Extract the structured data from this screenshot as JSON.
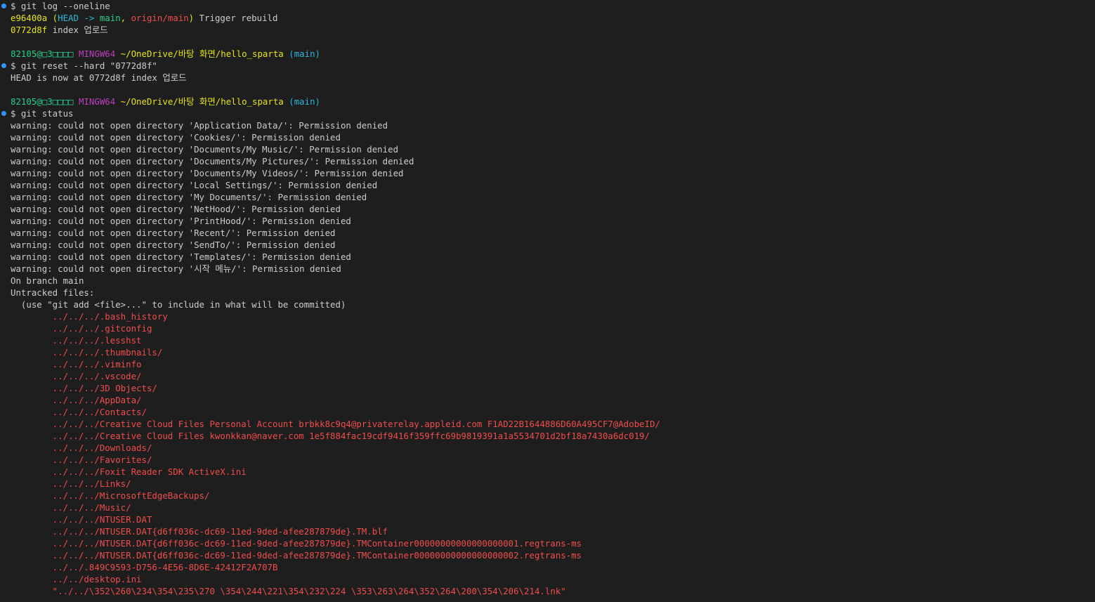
{
  "theme": {
    "background": "#1e1e1e",
    "foreground": "#cccccc",
    "marker": "#3794ff",
    "yellow": "#e5e510",
    "cyan": "#29b8db",
    "green": "#23d18b",
    "red": "#f14c4c",
    "magenta": "#bc3fbc"
  },
  "lines": [
    {
      "marker": true,
      "segments": [
        {
          "text": "$ git log --oneline",
          "c": "default"
        }
      ]
    },
    {
      "segments": [
        {
          "text": "e96400a",
          "c": "yellow"
        },
        {
          "text": " (",
          "c": "yellow"
        },
        {
          "text": "HEAD -> ",
          "c": "cyan"
        },
        {
          "text": "main",
          "c": "green"
        },
        {
          "text": ", ",
          "c": "yellow"
        },
        {
          "text": "origin/main",
          "c": "red"
        },
        {
          "text": ")",
          "c": "yellow"
        },
        {
          "text": " Trigger rebuild",
          "c": "default"
        }
      ]
    },
    {
      "segments": [
        {
          "text": "0772d8f",
          "c": "yellow"
        },
        {
          "text": " index 업로드",
          "c": "default"
        }
      ]
    },
    {
      "segments": []
    },
    {
      "segments": [
        {
          "text": "82105@□3□□□□",
          "c": "green"
        },
        {
          "text": " MINGW64",
          "c": "magenta"
        },
        {
          "text": " ~/OneDrive/바탕 화면/hello_sparta",
          "c": "yellow"
        },
        {
          "text": " (main)",
          "c": "cyan"
        }
      ]
    },
    {
      "marker": true,
      "segments": [
        {
          "text": "$ git reset --hard \"0772d8f\"",
          "c": "default"
        }
      ]
    },
    {
      "segments": [
        {
          "text": "HEAD is now at 0772d8f index 업로드",
          "c": "default"
        }
      ]
    },
    {
      "segments": []
    },
    {
      "segments": [
        {
          "text": "82105@□3□□□□",
          "c": "green"
        },
        {
          "text": " MINGW64",
          "c": "magenta"
        },
        {
          "text": " ~/OneDrive/바탕 화면/hello_sparta",
          "c": "yellow"
        },
        {
          "text": " (main)",
          "c": "cyan"
        }
      ]
    },
    {
      "marker": true,
      "segments": [
        {
          "text": "$ git status",
          "c": "default"
        }
      ]
    },
    {
      "segments": [
        {
          "text": "warning: could not open directory 'Application Data/': Permission denied",
          "c": "default"
        }
      ]
    },
    {
      "segments": [
        {
          "text": "warning: could not open directory 'Cookies/': Permission denied",
          "c": "default"
        }
      ]
    },
    {
      "segments": [
        {
          "text": "warning: could not open directory 'Documents/My Music/': Permission denied",
          "c": "default"
        }
      ]
    },
    {
      "segments": [
        {
          "text": "warning: could not open directory 'Documents/My Pictures/': Permission denied",
          "c": "default"
        }
      ]
    },
    {
      "segments": [
        {
          "text": "warning: could not open directory 'Documents/My Videos/': Permission denied",
          "c": "default"
        }
      ]
    },
    {
      "segments": [
        {
          "text": "warning: could not open directory 'Local Settings/': Permission denied",
          "c": "default"
        }
      ]
    },
    {
      "segments": [
        {
          "text": "warning: could not open directory 'My Documents/': Permission denied",
          "c": "default"
        }
      ]
    },
    {
      "segments": [
        {
          "text": "warning: could not open directory 'NetHood/': Permission denied",
          "c": "default"
        }
      ]
    },
    {
      "segments": [
        {
          "text": "warning: could not open directory 'PrintHood/': Permission denied",
          "c": "default"
        }
      ]
    },
    {
      "segments": [
        {
          "text": "warning: could not open directory 'Recent/': Permission denied",
          "c": "default"
        }
      ]
    },
    {
      "segments": [
        {
          "text": "warning: could not open directory 'SendTo/': Permission denied",
          "c": "default"
        }
      ]
    },
    {
      "segments": [
        {
          "text": "warning: could not open directory 'Templates/': Permission denied",
          "c": "default"
        }
      ]
    },
    {
      "segments": [
        {
          "text": "warning: could not open directory '시작 메뉴/': Permission denied",
          "c": "default"
        }
      ]
    },
    {
      "segments": [
        {
          "text": "On branch main",
          "c": "default"
        }
      ]
    },
    {
      "segments": [
        {
          "text": "Untracked files:",
          "c": "default"
        }
      ]
    },
    {
      "segments": [
        {
          "text": "  (use \"git add <file>...\" to include in what will be committed)",
          "c": "default"
        }
      ]
    },
    {
      "segments": [
        {
          "text": "        ../../../.bash_history",
          "c": "red"
        }
      ]
    },
    {
      "segments": [
        {
          "text": "        ../../../.gitconfig",
          "c": "red"
        }
      ]
    },
    {
      "segments": [
        {
          "text": "        ../../../.lesshst",
          "c": "red"
        }
      ]
    },
    {
      "segments": [
        {
          "text": "        ../../../.thumbnails/",
          "c": "red"
        }
      ]
    },
    {
      "segments": [
        {
          "text": "        ../../../.viminfo",
          "c": "red"
        }
      ]
    },
    {
      "segments": [
        {
          "text": "        ../../../.vscode/",
          "c": "red"
        }
      ]
    },
    {
      "segments": [
        {
          "text": "        ../../../3D Objects/",
          "c": "red"
        }
      ]
    },
    {
      "segments": [
        {
          "text": "        ../../../AppData/",
          "c": "red"
        }
      ]
    },
    {
      "segments": [
        {
          "text": "        ../../../Contacts/",
          "c": "red"
        }
      ]
    },
    {
      "segments": [
        {
          "text": "        ../../../Creative Cloud Files Personal Account brbkk8c9q4@privaterelay.appleid.com F1AD22B1644886D60A495CF7@AdobeID/",
          "c": "red"
        }
      ]
    },
    {
      "segments": [
        {
          "text": "        ../../../Creative Cloud Files kwonkkan@naver.com 1e5f884fac19cdf9416f359ffc69b9819391a1a5534701d2bf18a7430a6dc019/",
          "c": "red"
        }
      ]
    },
    {
      "segments": [
        {
          "text": "        ../../../Downloads/",
          "c": "red"
        }
      ]
    },
    {
      "segments": [
        {
          "text": "        ../../../Favorites/",
          "c": "red"
        }
      ]
    },
    {
      "segments": [
        {
          "text": "        ../../../Foxit Reader SDK ActiveX.ini",
          "c": "red"
        }
      ]
    },
    {
      "segments": [
        {
          "text": "        ../../../Links/",
          "c": "red"
        }
      ]
    },
    {
      "segments": [
        {
          "text": "        ../../../MicrosoftEdgeBackups/",
          "c": "red"
        }
      ]
    },
    {
      "segments": [
        {
          "text": "        ../../../Music/",
          "c": "red"
        }
      ]
    },
    {
      "segments": [
        {
          "text": "        ../../../NTUSER.DAT",
          "c": "red"
        }
      ]
    },
    {
      "segments": [
        {
          "text": "        ../../../NTUSER.DAT{d6ff036c-dc69-11ed-9ded-afee287879de}.TM.blf",
          "c": "red"
        }
      ]
    },
    {
      "segments": [
        {
          "text": "        ../../../NTUSER.DAT{d6ff036c-dc69-11ed-9ded-afee287879de}.TMContainer00000000000000000001.regtrans-ms",
          "c": "red"
        }
      ]
    },
    {
      "segments": [
        {
          "text": "        ../../../NTUSER.DAT{d6ff036c-dc69-11ed-9ded-afee287879de}.TMContainer00000000000000000002.regtrans-ms",
          "c": "red"
        }
      ]
    },
    {
      "segments": [
        {
          "text": "        ../../.849C9593-D756-4E56-8D6E-42412F2A707B",
          "c": "red"
        }
      ]
    },
    {
      "segments": [
        {
          "text": "        ../../desktop.ini",
          "c": "red"
        }
      ]
    },
    {
      "segments": [
        {
          "text": "        \"../../\\352\\260\\234\\354\\235\\270 \\354\\244\\221\\354\\232\\224 \\353\\263\\264\\352\\264\\200\\354\\206\\214.lnk\"",
          "c": "red"
        }
      ]
    }
  ]
}
